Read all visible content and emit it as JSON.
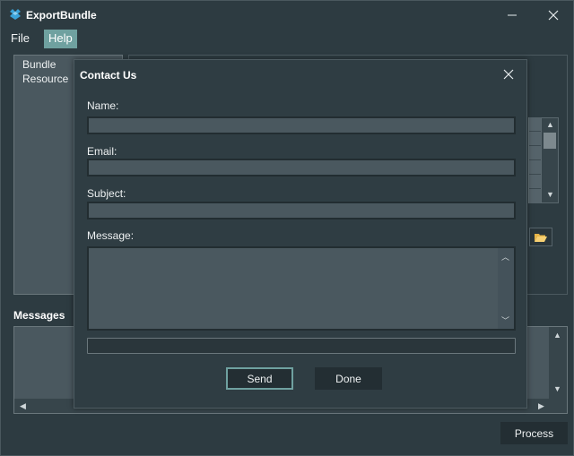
{
  "app": {
    "title": "ExportBundle",
    "icon": "bundle-app-icon"
  },
  "menu": {
    "file": "File",
    "help": "Help"
  },
  "tree": {
    "items": [
      "Bundle",
      "Resource"
    ]
  },
  "messages": {
    "label": "Messages"
  },
  "process": {
    "label": "Process"
  },
  "dialog": {
    "title": "Contact Us",
    "name_label": "Name:",
    "name_value": "",
    "email_label": "Email:",
    "email_value": "",
    "subject_label": "Subject:",
    "subject_value": "",
    "message_label": "Message:",
    "message_value": "",
    "progress": 0,
    "send_label": "Send",
    "done_label": "Done"
  },
  "colors": {
    "accent": "#6fa1a0",
    "background": "#2d3b41",
    "field": "#4a585f",
    "button": "#232e33"
  }
}
